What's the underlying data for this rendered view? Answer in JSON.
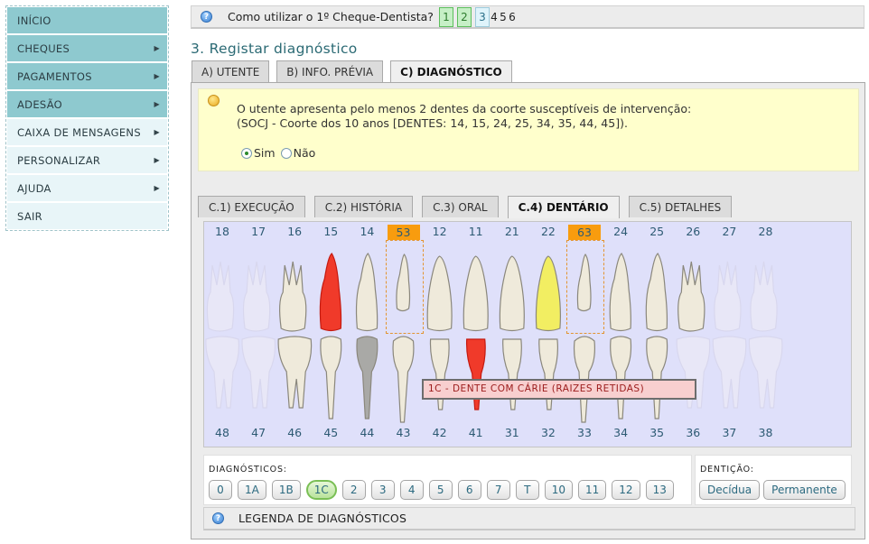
{
  "sidebar": {
    "items": [
      {
        "label": "INÍCIO",
        "has_submenu": false,
        "style": "dark"
      },
      {
        "label": "CHEQUES",
        "has_submenu": true,
        "style": "dark"
      },
      {
        "label": "PAGAMENTOS",
        "has_submenu": true,
        "style": "dark"
      },
      {
        "label": "ADESÃO",
        "has_submenu": true,
        "style": "dark"
      },
      {
        "label": "CAIXA DE MENSAGENS",
        "has_submenu": true,
        "style": "light"
      },
      {
        "label": "PERSONALIZAR",
        "has_submenu": true,
        "style": "light"
      },
      {
        "label": "AJUDA",
        "has_submenu": true,
        "style": "light"
      },
      {
        "label": "SAIR",
        "has_submenu": false,
        "style": "light"
      }
    ],
    "arrow_glyph": "▶"
  },
  "helpbar": {
    "icon": "help-icon",
    "icon_glyph": "?",
    "text": "Como utilizar o 1º Cheque-Dentista?",
    "steps": [
      {
        "label": "1",
        "state": "done"
      },
      {
        "label": "2",
        "state": "done"
      },
      {
        "label": "3",
        "state": "current"
      },
      {
        "label": "4",
        "state": "future"
      },
      {
        "label": "5",
        "state": "future"
      },
      {
        "label": "6",
        "state": "future"
      }
    ]
  },
  "page": {
    "title": "3. Registar diagnóstico"
  },
  "main_tabs": [
    {
      "label": "A) UTENTE",
      "active": false
    },
    {
      "label": "B) INFO. PRÉVIA",
      "active": false
    },
    {
      "label": "C) DIAGNÓSTICO",
      "active": true
    }
  ],
  "notice": {
    "line1": "O utente apresenta pelo menos 2 dentes da coorte susceptíveis de intervenção:",
    "line2": "(SOCJ - Coorte dos 10 anos [DENTES: 14, 15, 24, 25, 34, 35, 44, 45]).",
    "options": [
      {
        "label": "Sim",
        "checked": true
      },
      {
        "label": "Não",
        "checked": false
      }
    ]
  },
  "sub_tabs": [
    {
      "label": "C.1) EXECUÇÃO",
      "active": false
    },
    {
      "label": "C.2) HISTÓRIA",
      "active": false
    },
    {
      "label": "C.3) ORAL",
      "active": false
    },
    {
      "label": "C.4) DENTÁRIO",
      "active": true
    },
    {
      "label": "C.5) DETALHES",
      "active": false
    }
  ],
  "dental_chart": {
    "upper": [
      {
        "num": "18",
        "kind": "molar",
        "state": "faded"
      },
      {
        "num": "17",
        "kind": "molar",
        "state": "faded"
      },
      {
        "num": "16",
        "kind": "molar",
        "state": "normal"
      },
      {
        "num": "15",
        "kind": "premolar",
        "state": "red"
      },
      {
        "num": "14",
        "kind": "premolar",
        "state": "normal"
      },
      {
        "num": "53",
        "kind": "deciduous",
        "state": "selected"
      },
      {
        "num": "12",
        "kind": "incisor",
        "state": "normal"
      },
      {
        "num": "11",
        "kind": "incisor",
        "state": "normal"
      },
      {
        "num": "21",
        "kind": "incisor",
        "state": "normal"
      },
      {
        "num": "22",
        "kind": "incisor",
        "state": "yellow"
      },
      {
        "num": "63",
        "kind": "deciduous",
        "state": "selected"
      },
      {
        "num": "24",
        "kind": "premolar",
        "state": "normal"
      },
      {
        "num": "25",
        "kind": "premolar",
        "state": "normal"
      },
      {
        "num": "26",
        "kind": "molar",
        "state": "normal"
      },
      {
        "num": "27",
        "kind": "molar",
        "state": "faded"
      },
      {
        "num": "28",
        "kind": "molar",
        "state": "faded"
      }
    ],
    "lower": [
      {
        "num": "48",
        "kind": "molar",
        "state": "faded"
      },
      {
        "num": "47",
        "kind": "molar",
        "state": "faded"
      },
      {
        "num": "46",
        "kind": "molar",
        "state": "normal"
      },
      {
        "num": "45",
        "kind": "premolar",
        "state": "normal"
      },
      {
        "num": "44",
        "kind": "premolar",
        "state": "grey"
      },
      {
        "num": "43",
        "kind": "canine",
        "state": "normal"
      },
      {
        "num": "42",
        "kind": "incisor",
        "state": "normal"
      },
      {
        "num": "41",
        "kind": "incisor",
        "state": "red"
      },
      {
        "num": "31",
        "kind": "incisor",
        "state": "normal"
      },
      {
        "num": "32",
        "kind": "incisor",
        "state": "normal"
      },
      {
        "num": "33",
        "kind": "canine",
        "state": "normal"
      },
      {
        "num": "34",
        "kind": "premolar",
        "state": "normal"
      },
      {
        "num": "35",
        "kind": "premolar",
        "state": "normal"
      },
      {
        "num": "36",
        "kind": "molar",
        "state": "faded"
      },
      {
        "num": "37",
        "kind": "molar",
        "state": "faded"
      },
      {
        "num": "38",
        "kind": "molar",
        "state": "faded"
      }
    ],
    "colors": {
      "normal": "#efeadb",
      "faded": "#eceaf6",
      "red": "#f03a2a",
      "yellow": "#f2ee62",
      "grey": "#a9a9a6",
      "highlight": "#f89c0e"
    },
    "tooltip": "1C - DENTE COM CÁRIE (RAIZES RETIDAS)"
  },
  "diagnostics": {
    "label": "DIAGNÓSTICOS:",
    "buttons": [
      {
        "label": "0",
        "selected": false
      },
      {
        "label": "1A",
        "selected": false
      },
      {
        "label": "1B",
        "selected": false
      },
      {
        "label": "1C",
        "selected": true
      },
      {
        "label": "2",
        "selected": false
      },
      {
        "label": "3",
        "selected": false
      },
      {
        "label": "4",
        "selected": false
      },
      {
        "label": "5",
        "selected": false
      },
      {
        "label": "6",
        "selected": false
      },
      {
        "label": "7",
        "selected": false
      },
      {
        "label": "T",
        "selected": false
      },
      {
        "label": "10",
        "selected": false
      },
      {
        "label": "11",
        "selected": false
      },
      {
        "label": "12",
        "selected": false
      },
      {
        "label": "13",
        "selected": false
      }
    ]
  },
  "dentition": {
    "label": "DENTIÇÃO:",
    "buttons": [
      {
        "label": "Decídua"
      },
      {
        "label": "Permanente"
      }
    ]
  },
  "legend": {
    "icon": "help-icon",
    "icon_glyph": "?",
    "label": "LEGENDA DE DIAGNÓSTICOS"
  }
}
